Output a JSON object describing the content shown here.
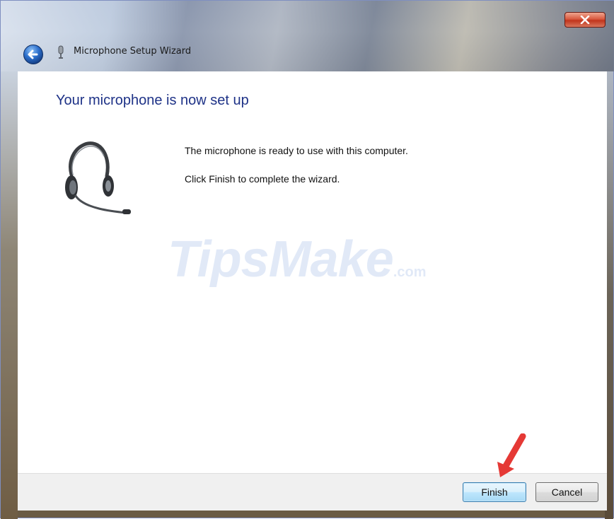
{
  "window": {
    "title": "Microphone Setup Wizard",
    "close_icon": "close-icon",
    "back_icon": "back-arrow-icon"
  },
  "content": {
    "heading": "Your microphone is now set up",
    "illustration_icon": "headset-icon",
    "message_ready": "The microphone is ready to use with this computer.",
    "message_finish": "Click Finish to complete the wizard."
  },
  "watermark": {
    "main": "TipsMake",
    "suffix": ".com"
  },
  "footer": {
    "finish_label": "Finish",
    "cancel_label": "Cancel"
  },
  "annotation": {
    "arrow_icon": "red-arrow-icon",
    "color": "#e53935"
  },
  "colors": {
    "heading": "#1e3287",
    "default_button_border": "#3c7fb1"
  }
}
